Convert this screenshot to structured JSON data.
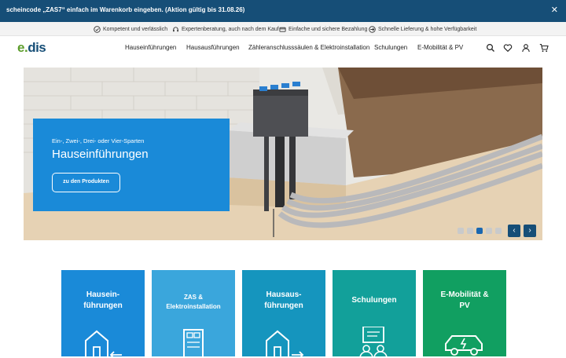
{
  "promo": {
    "text": "scheincode „ZAS7“ einfach im Warenkorb eingeben. (Aktion gültig bis 31.08.26)",
    "close": "✕"
  },
  "usp": [
    {
      "icon": "checkmark-circle-icon",
      "label": "Kompetent und verlässlich"
    },
    {
      "icon": "headset-icon",
      "label": "Expertenberatung, auch nach dem Kauf"
    },
    {
      "icon": "credit-card-icon",
      "label": "Einfache und sichere Bezahlung"
    },
    {
      "icon": "delivery-icon",
      "label": "Schnelle Lieferung & hohe Verfügbarkeit"
    }
  ],
  "logo": {
    "e": "e",
    "dot": ".",
    "dis": "dis"
  },
  "nav": [
    "Hauseinführungen",
    "Hausausführungen",
    "Zähleranschluss säulen & Elektroinstallation",
    "Schulungen",
    "E-Mobilität & PV"
  ],
  "hero": {
    "subtitle": "Ein-, Zwei-, Drei- oder Vier-Sparten",
    "title": "Hauseinführungen",
    "button": "zu den Produkten",
    "prev": "‹",
    "next": "›",
    "slide_count": 5,
    "active_slide": 3
  },
  "tiles": [
    {
      "line1": "Hausein-",
      "line2": "führungen",
      "color": "#1a8ad8",
      "icon": "house-entry-icon"
    },
    {
      "line1": "ZAS &",
      "line2": "Elektroinstallation",
      "color": "#3aa6dc",
      "icon": "meter-cabinet-icon"
    },
    {
      "line1": "Hausaus-",
      "line2": "führungen",
      "color": "#1595be",
      "icon": "house-exit-icon"
    },
    {
      "line1": "Schulungen",
      "line2": "",
      "color": "#12a09a",
      "icon": "training-icon"
    },
    {
      "line1": "E-Mobilität &",
      "line2": "PV",
      "color": "#119f61",
      "icon": "electric-car-icon"
    }
  ]
}
